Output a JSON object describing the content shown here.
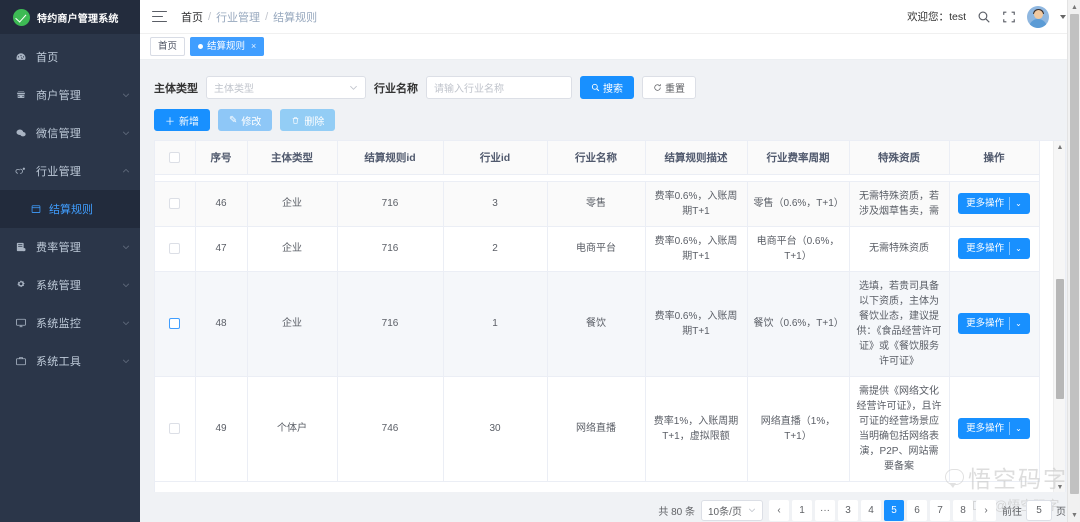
{
  "sidebar": {
    "logo_text": "特约商户管理系统",
    "items": [
      {
        "label": "首页",
        "icon": "dashboard-icon",
        "has_arrow": false
      },
      {
        "label": "商户管理",
        "icon": "shop-icon",
        "has_arrow": true
      },
      {
        "label": "微信管理",
        "icon": "wechat-icon",
        "has_arrow": true
      },
      {
        "label": "行业管理",
        "icon": "industry-icon",
        "has_arrow": true,
        "expanded": true
      }
    ],
    "submenu": [
      {
        "label": "结算规则",
        "icon": "rule-icon",
        "active": true
      }
    ],
    "items_after": [
      {
        "label": "费率管理",
        "icon": "rate-icon",
        "has_arrow": true
      },
      {
        "label": "系统管理",
        "icon": "gear-icon",
        "has_arrow": true
      },
      {
        "label": "系统监控",
        "icon": "monitor-icon",
        "has_arrow": true
      },
      {
        "label": "系统工具",
        "icon": "toolbox-icon",
        "has_arrow": true
      }
    ]
  },
  "navbar": {
    "breadcrumb": [
      "首页",
      "行业管理",
      "结算规则"
    ],
    "breadcrumb_sep": "/",
    "welcome_label": "欢迎您：",
    "username": "test",
    "search_icon": "search-icon",
    "fullscreen_icon": "fullscreen-icon"
  },
  "tabs": [
    {
      "label": "首页",
      "active": false,
      "closable": false
    },
    {
      "label": "结算规则",
      "active": true,
      "closable": true,
      "close_glyph": "×"
    }
  ],
  "filter": {
    "subject_type_label": "主体类型",
    "subject_type_value": "",
    "subject_type_placeholder": "主体类型",
    "industry_name_label": "行业名称",
    "industry_name_value": "",
    "industry_name_placeholder": "请输入行业名称",
    "search_button": "搜索",
    "reset_button": "重置"
  },
  "toolbar": {
    "add_label": "新增",
    "add_glyph": "＋",
    "edit_label": "修改",
    "edit_glyph": "✎",
    "delete_label": "删除",
    "delete_glyph": "🗑"
  },
  "table": {
    "columns": [
      "",
      "序号",
      "主体类型",
      "结算规则id",
      "行业id",
      "行业名称",
      "结算规则描述",
      "行业费率周期",
      "特殊资质",
      "操作"
    ],
    "action_label": "更多操作",
    "action_chevron": "⌄",
    "rows": [
      {
        "seq": "46",
        "subject_type": "企业",
        "rule_id": "716",
        "industry_id": "3",
        "industry_name": "零售",
        "rule_desc": "费率0.6%，入账周期T+1",
        "rate_cycle": "零售（0.6%，T+1）",
        "special": "无需特殊资质，若涉及烟草售卖，需",
        "selected": false,
        "striped": true
      },
      {
        "seq": "47",
        "subject_type": "企业",
        "rule_id": "716",
        "industry_id": "2",
        "industry_name": "电商平台",
        "rule_desc": "费率0.6%，入账周期T+1",
        "rate_cycle": "电商平台（0.6%，T+1）",
        "special": "无需特殊资质",
        "selected": false,
        "striped": false
      },
      {
        "seq": "48",
        "subject_type": "企业",
        "rule_id": "716",
        "industry_id": "1",
        "industry_name": "餐饮",
        "rule_desc": "费率0.6%，入账周期T+1",
        "rate_cycle": "餐饮（0.6%，T+1）",
        "special": "选填，若贵司具备以下资质，主体为餐饮业态，建议提供：《食品经营许可证》或《餐饮服务许可证》",
        "selected": true,
        "striped": true
      },
      {
        "seq": "49",
        "subject_type": "个体户",
        "rule_id": "746",
        "industry_id": "30",
        "industry_name": "网络直播",
        "rule_desc": "费率1%，入账周期T+1，虚拟限额",
        "rate_cycle": "网络直播（1%，T+1）",
        "special": "需提供《网络文化经营许可证》，且许可证的经营场景应当明确包括网络表演，P2P、网站需要备案",
        "selected": false,
        "striped": false
      }
    ]
  },
  "pagination": {
    "total_text": "共 80 条",
    "page_size": "10条/页",
    "prev_glyph": "‹",
    "next_glyph": "›",
    "pages": [
      "1",
      "···",
      "3",
      "4",
      "5",
      "6",
      "7",
      "8"
    ],
    "current_page": "5",
    "jump_prefix": "前往",
    "jump_value": "5",
    "jump_suffix": "页"
  },
  "watermark": {
    "main": "悟空码字",
    "sub": "CSDN @悟空码字"
  }
}
